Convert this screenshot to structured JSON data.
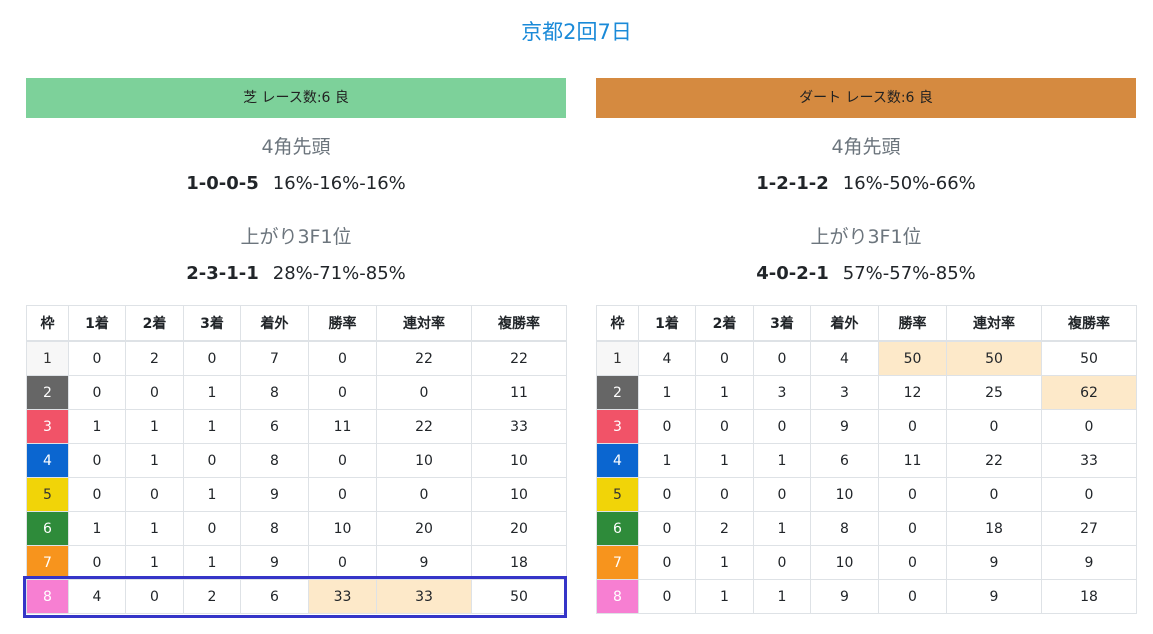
{
  "page_title": "京都2回7日",
  "colors": {
    "turf_header": "#7dd19a",
    "dirt_header": "#d58a40",
    "highlight_cell": "#fde9c9",
    "selection_box": "#3535c8"
  },
  "waku_colors": {
    "1": {
      "bg": "#f7f7f7",
      "fg": "#333333"
    },
    "2": {
      "bg": "#666666",
      "fg": "#ffffff"
    },
    "3": {
      "bg": "#f15368",
      "fg": "#ffffff"
    },
    "4": {
      "bg": "#0b66d0",
      "fg": "#ffffff"
    },
    "5": {
      "bg": "#f1d408",
      "fg": "#333333"
    },
    "6": {
      "bg": "#2e8b3a",
      "fg": "#ffffff"
    },
    "7": {
      "bg": "#f7941d",
      "fg": "#ffffff"
    },
    "8": {
      "bg": "#f77fd2",
      "fg": "#ffffff"
    }
  },
  "columns": [
    "枠",
    "1着",
    "2着",
    "3着",
    "着外",
    "勝率",
    "連対率",
    "複勝率"
  ],
  "turf": {
    "header": "芝 レース数:6 良",
    "corner_label": "4角先頭",
    "corner_score": "1-0-0-5",
    "corner_rates": "16%-16%-16%",
    "agari_label": "上がり3F1位",
    "agari_score": "2-3-1-1",
    "agari_rates": "28%-71%-85%",
    "rows": [
      {
        "waku": "1",
        "c": [
          "0",
          "2",
          "0",
          "7",
          "0",
          "22",
          "22"
        ],
        "hl": []
      },
      {
        "waku": "2",
        "c": [
          "0",
          "0",
          "1",
          "8",
          "0",
          "0",
          "11"
        ],
        "hl": []
      },
      {
        "waku": "3",
        "c": [
          "1",
          "1",
          "1",
          "6",
          "11",
          "22",
          "33"
        ],
        "hl": []
      },
      {
        "waku": "4",
        "c": [
          "0",
          "1",
          "0",
          "8",
          "0",
          "10",
          "10"
        ],
        "hl": []
      },
      {
        "waku": "5",
        "c": [
          "0",
          "0",
          "1",
          "9",
          "0",
          "0",
          "10"
        ],
        "hl": []
      },
      {
        "waku": "6",
        "c": [
          "1",
          "1",
          "0",
          "8",
          "10",
          "20",
          "20"
        ],
        "hl": []
      },
      {
        "waku": "7",
        "c": [
          "0",
          "1",
          "1",
          "9",
          "0",
          "9",
          "18"
        ],
        "hl": []
      },
      {
        "waku": "8",
        "c": [
          "4",
          "0",
          "2",
          "6",
          "33",
          "33",
          "50"
        ],
        "hl": [
          4,
          5
        ]
      }
    ]
  },
  "dirt": {
    "header": "ダート レース数:6 良",
    "corner_label": "4角先頭",
    "corner_score": "1-2-1-2",
    "corner_rates": "16%-50%-66%",
    "agari_label": "上がり3F1位",
    "agari_score": "4-0-2-1",
    "agari_rates": "57%-57%-85%",
    "rows": [
      {
        "waku": "1",
        "c": [
          "4",
          "0",
          "0",
          "4",
          "50",
          "50",
          "50"
        ],
        "hl": [
          4,
          5
        ]
      },
      {
        "waku": "2",
        "c": [
          "1",
          "1",
          "3",
          "3",
          "12",
          "25",
          "62"
        ],
        "hl": [
          6
        ]
      },
      {
        "waku": "3",
        "c": [
          "0",
          "0",
          "0",
          "9",
          "0",
          "0",
          "0"
        ],
        "hl": []
      },
      {
        "waku": "4",
        "c": [
          "1",
          "1",
          "1",
          "6",
          "11",
          "22",
          "33"
        ],
        "hl": []
      },
      {
        "waku": "5",
        "c": [
          "0",
          "0",
          "0",
          "10",
          "0",
          "0",
          "0"
        ],
        "hl": []
      },
      {
        "waku": "6",
        "c": [
          "0",
          "2",
          "1",
          "8",
          "0",
          "18",
          "27"
        ],
        "hl": []
      },
      {
        "waku": "7",
        "c": [
          "0",
          "1",
          "0",
          "10",
          "0",
          "9",
          "9"
        ],
        "hl": []
      },
      {
        "waku": "8",
        "c": [
          "0",
          "1",
          "1",
          "9",
          "0",
          "9",
          "18"
        ],
        "hl": []
      }
    ]
  }
}
